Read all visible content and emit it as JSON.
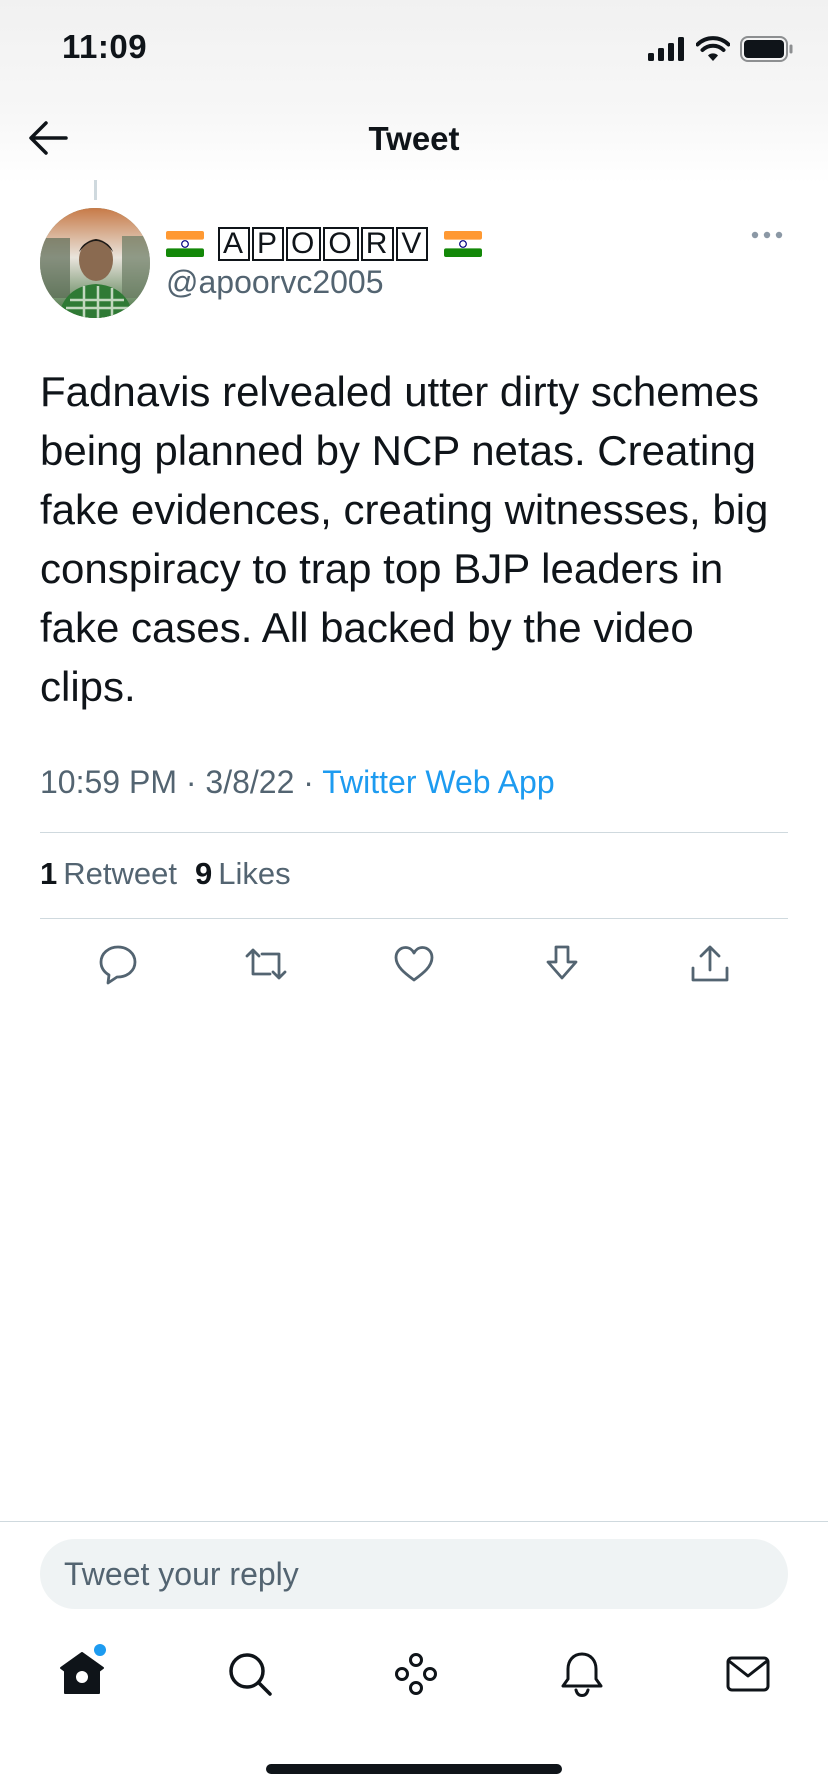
{
  "status_bar": {
    "time": "11:09"
  },
  "header": {
    "title": "Tweet"
  },
  "tweet": {
    "author_name_flag_emoji": "🇮🇳",
    "author_name_letters": [
      "A",
      "P",
      "O",
      "O",
      "R",
      "V"
    ],
    "author_handle": "@apoorvc2005",
    "text": "Fadnavis relvealed utter dirty schemes being planned by NCP netas. Creating fake evidences, creating witnesses, big conspiracy to trap top BJP leaders in fake cases. All backed by the video clips.",
    "time": "10:59 PM",
    "date": "3/8/22",
    "source": "Twitter Web App",
    "separator": "·",
    "retweet_count": "1",
    "retweet_label": "Retweet",
    "like_count": "9",
    "like_label": "Likes"
  },
  "actions": [
    "reply-icon",
    "retweet-icon",
    "like-icon",
    "bookmark-icon",
    "share-icon"
  ],
  "composer": {
    "placeholder": "Tweet your reply"
  },
  "bottom_nav": [
    "home-icon",
    "search-icon",
    "spaces-icon",
    "notifications-icon",
    "messages-icon"
  ],
  "colors": {
    "accent": "#1d9bf0",
    "text": "#0f1419",
    "secondary": "#536471",
    "divider": "#cfd9de"
  }
}
